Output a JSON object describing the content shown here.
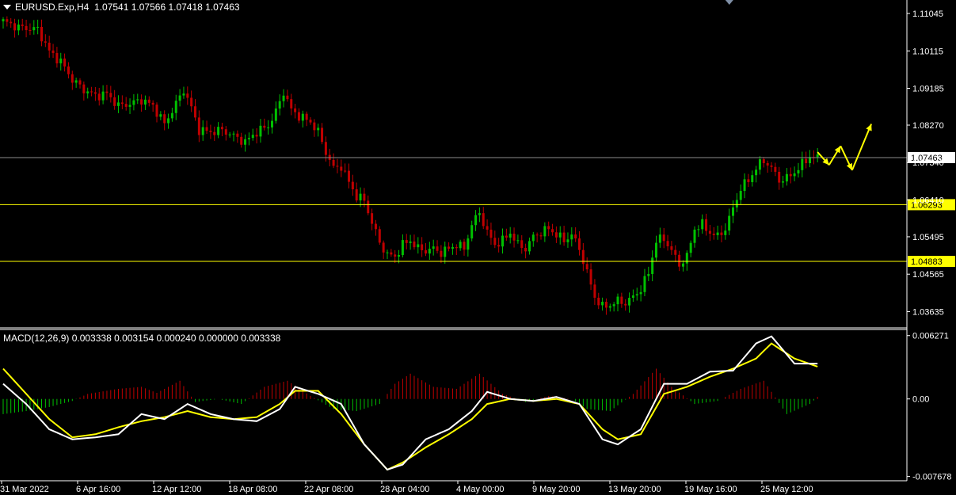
{
  "header": {
    "symbol": "EURUSD.Exp,H4",
    "ohlc": "1.07541 1.07566 1.07418 1.07463"
  },
  "macd_header": {
    "label": "MACD(12,26,9) 0.003338 0.003154 0.000240 0.000000 0.003338"
  },
  "colors": {
    "background": "#000000",
    "bull": "#00c000",
    "bear": "#c00000",
    "macd_line": "#ffffff",
    "signal_line": "#ffff00",
    "level_line": "#ffff00",
    "current_line": "#8c8c8c",
    "arrow": "#ffff00"
  },
  "chart_data": [
    {
      "type": "candlestick",
      "symbol": "EURUSD.Exp",
      "timeframe": "H4",
      "ylim": [
        1.0325,
        1.1138
      ],
      "y_ticks": [
        "1.11045",
        "1.10115",
        "1.09185",
        "1.08270",
        "1.07340",
        "1.06410",
        "1.05495",
        "1.04565",
        "1.03635"
      ],
      "x_ticks": [
        "31 Mar 2022",
        "6 Apr 16:00",
        "12 Apr 12:00",
        "18 Apr 08:00",
        "22 Apr 08:00",
        "28 Apr 04:00",
        "4 May 00:00",
        "9 May 20:00",
        "13 May 20:00",
        "19 May 16:00",
        "25 May 12:00"
      ],
      "close_path": [
        {
          "t": 0,
          "v": 1.1085
        },
        {
          "t": 4,
          "v": 1.107
        },
        {
          "t": 9,
          "v": 1.1065
        },
        {
          "t": 12,
          "v": 1.101
        },
        {
          "t": 15,
          "v": 1.0985
        },
        {
          "t": 18,
          "v": 1.094
        },
        {
          "t": 21,
          "v": 1.0915
        },
        {
          "t": 24,
          "v": 1.09
        },
        {
          "t": 27,
          "v": 1.0905
        },
        {
          "t": 30,
          "v": 1.0875
        },
        {
          "t": 33,
          "v": 1.088
        },
        {
          "t": 36,
          "v": 1.089
        },
        {
          "t": 39,
          "v": 1.0875
        },
        {
          "t": 42,
          "v": 1.083
        },
        {
          "t": 45,
          "v": 1.088
        },
        {
          "t": 47,
          "v": 1.0915
        },
        {
          "t": 49,
          "v": 1.087
        },
        {
          "t": 51,
          "v": 1.0815
        },
        {
          "t": 54,
          "v": 1.081
        },
        {
          "t": 57,
          "v": 1.0815
        },
        {
          "t": 60,
          "v": 1.08
        },
        {
          "t": 63,
          "v": 1.0785
        },
        {
          "t": 66,
          "v": 1.081
        },
        {
          "t": 69,
          "v": 1.0825
        },
        {
          "t": 71,
          "v": 1.086
        },
        {
          "t": 73,
          "v": 1.091
        },
        {
          "t": 75,
          "v": 1.0865
        },
        {
          "t": 77,
          "v": 1.085
        },
        {
          "t": 80,
          "v": 1.0835
        },
        {
          "t": 82,
          "v": 1.081
        },
        {
          "t": 84,
          "v": 1.076
        },
        {
          "t": 86,
          "v": 1.072
        },
        {
          "t": 88,
          "v": 1.0725
        },
        {
          "t": 90,
          "v": 1.0685
        },
        {
          "t": 92,
          "v": 1.065
        },
        {
          "t": 94,
          "v": 1.064
        },
        {
          "t": 96,
          "v": 1.0585
        },
        {
          "t": 98,
          "v": 1.0535
        },
        {
          "t": 100,
          "v": 1.0505
        },
        {
          "t": 102,
          "v": 1.05
        },
        {
          "t": 104,
          "v": 1.053
        },
        {
          "t": 106,
          "v": 1.054
        },
        {
          "t": 108,
          "v": 1.052
        },
        {
          "t": 110,
          "v": 1.0515
        },
        {
          "t": 112,
          "v": 1.052
        },
        {
          "t": 114,
          "v": 1.051
        },
        {
          "t": 116,
          "v": 1.052
        },
        {
          "t": 118,
          "v": 1.053
        },
        {
          "t": 120,
          "v": 1.052
        },
        {
          "t": 122,
          "v": 1.058
        },
        {
          "t": 124,
          "v": 1.061
        },
        {
          "t": 126,
          "v": 1.056
        },
        {
          "t": 128,
          "v": 1.053
        },
        {
          "t": 130,
          "v": 1.054
        },
        {
          "t": 132,
          "v": 1.056
        },
        {
          "t": 134,
          "v": 1.053
        },
        {
          "t": 136,
          "v": 1.052
        },
        {
          "t": 138,
          "v": 1.055
        },
        {
          "t": 140,
          "v": 1.056
        },
        {
          "t": 142,
          "v": 1.057
        },
        {
          "t": 144,
          "v": 1.0555
        },
        {
          "t": 146,
          "v": 1.054
        },
        {
          "t": 148,
          "v": 1.0555
        },
        {
          "t": 150,
          "v": 1.052
        },
        {
          "t": 152,
          "v": 1.046
        },
        {
          "t": 154,
          "v": 1.04
        },
        {
          "t": 156,
          "v": 1.0375
        },
        {
          "t": 158,
          "v": 1.038
        },
        {
          "t": 160,
          "v": 1.039
        },
        {
          "t": 162,
          "v": 1.0385
        },
        {
          "t": 164,
          "v": 1.04
        },
        {
          "t": 166,
          "v": 1.042
        },
        {
          "t": 168,
          "v": 1.046
        },
        {
          "t": 170,
          "v": 1.054
        },
        {
          "t": 172,
          "v": 1.0545
        },
        {
          "t": 174,
          "v": 1.0515
        },
        {
          "t": 176,
          "v": 1.048
        },
        {
          "t": 178,
          "v": 1.05
        },
        {
          "t": 180,
          "v": 1.057
        },
        {
          "t": 182,
          "v": 1.058
        },
        {
          "t": 184,
          "v": 1.056
        },
        {
          "t": 186,
          "v": 1.055
        },
        {
          "t": 188,
          "v": 1.057
        },
        {
          "t": 190,
          "v": 1.062
        },
        {
          "t": 192,
          "v": 1.067
        },
        {
          "t": 194,
          "v": 1.069
        },
        {
          "t": 196,
          "v": 1.072
        },
        {
          "t": 198,
          "v": 1.074
        },
        {
          "t": 200,
          "v": 1.072
        },
        {
          "t": 202,
          "v": 1.069
        },
        {
          "t": 204,
          "v": 1.0695
        },
        {
          "t": 206,
          "v": 1.071
        },
        {
          "t": 208,
          "v": 1.073
        },
        {
          "t": 210,
          "v": 1.075
        },
        {
          "t": 212,
          "v": 1.0745
        }
      ],
      "horizontal_lines": [
        {
          "label": "1.07463",
          "value": 1.07463,
          "kind": "current"
        },
        {
          "label": "1.06293",
          "value": 1.06293,
          "kind": "level"
        },
        {
          "label": "1.04883",
          "value": 1.04883,
          "kind": "level"
        }
      ],
      "forecast_arrows": [
        {
          "from": {
            "t": 212,
            "v": 1.076
          },
          "to": {
            "t": 215,
            "v": 1.0728
          }
        },
        {
          "from": {
            "t": 215,
            "v": 1.0728
          },
          "to": {
            "t": 218,
            "v": 1.0775
          }
        },
        {
          "from": {
            "t": 218,
            "v": 1.0775
          },
          "to": {
            "t": 221,
            "v": 1.0715
          }
        },
        {
          "from": {
            "t": 221,
            "v": 1.0715
          },
          "to": {
            "t": 226,
            "v": 1.083
          }
        }
      ]
    },
    {
      "type": "line",
      "name": "MACD(12,26,9)",
      "ylim": [
        -0.0081,
        0.0068
      ],
      "y_ticks": [
        "0.006271",
        "0.00",
        "-0.007678"
      ],
      "main": [
        {
          "t": 0,
          "v": 0.0015
        },
        {
          "t": 6,
          "v": -0.0005
        },
        {
          "t": 12,
          "v": -0.003
        },
        {
          "t": 18,
          "v": -0.004
        },
        {
          "t": 24,
          "v": -0.0038
        },
        {
          "t": 30,
          "v": -0.0035
        },
        {
          "t": 36,
          "v": -0.0015
        },
        {
          "t": 42,
          "v": -0.002
        },
        {
          "t": 48,
          "v": -0.0005
        },
        {
          "t": 54,
          "v": -0.0015
        },
        {
          "t": 60,
          "v": -0.002
        },
        {
          "t": 66,
          "v": -0.0022
        },
        {
          "t": 72,
          "v": -0.001
        },
        {
          "t": 76,
          "v": 0.0012
        },
        {
          "t": 82,
          "v": 0.0005
        },
        {
          "t": 88,
          "v": -0.0005
        },
        {
          "t": 94,
          "v": -0.0045
        },
        {
          "t": 100,
          "v": -0.007
        },
        {
          "t": 104,
          "v": -0.0065
        },
        {
          "t": 110,
          "v": -0.004
        },
        {
          "t": 116,
          "v": -0.003
        },
        {
          "t": 122,
          "v": -0.0012
        },
        {
          "t": 126,
          "v": 0.0007
        },
        {
          "t": 132,
          "v": 0.0
        },
        {
          "t": 138,
          "v": -0.0002
        },
        {
          "t": 144,
          "v": 0.0002
        },
        {
          "t": 150,
          "v": -0.0005
        },
        {
          "t": 156,
          "v": -0.004
        },
        {
          "t": 160,
          "v": -0.0045
        },
        {
          "t": 166,
          "v": -0.003
        },
        {
          "t": 172,
          "v": 0.0015
        },
        {
          "t": 178,
          "v": 0.0015
        },
        {
          "t": 184,
          "v": 0.0027
        },
        {
          "t": 190,
          "v": 0.0028
        },
        {
          "t": 196,
          "v": 0.0055
        },
        {
          "t": 200,
          "v": 0.0062
        },
        {
          "t": 206,
          "v": 0.0035
        },
        {
          "t": 212,
          "v": 0.0035
        }
      ],
      "signal": [
        {
          "t": 0,
          "v": 0.003
        },
        {
          "t": 6,
          "v": 0.0005
        },
        {
          "t": 12,
          "v": -0.002
        },
        {
          "t": 18,
          "v": -0.0038
        },
        {
          "t": 24,
          "v": -0.0035
        },
        {
          "t": 30,
          "v": -0.0028
        },
        {
          "t": 36,
          "v": -0.0022
        },
        {
          "t": 42,
          "v": -0.0018
        },
        {
          "t": 48,
          "v": -0.0012
        },
        {
          "t": 54,
          "v": -0.0018
        },
        {
          "t": 60,
          "v": -0.002
        },
        {
          "t": 66,
          "v": -0.0018
        },
        {
          "t": 72,
          "v": -0.0005
        },
        {
          "t": 76,
          "v": 0.0008
        },
        {
          "t": 82,
          "v": 0.0008
        },
        {
          "t": 88,
          "v": -0.0015
        },
        {
          "t": 94,
          "v": -0.0045
        },
        {
          "t": 100,
          "v": -0.007
        },
        {
          "t": 104,
          "v": -0.0063
        },
        {
          "t": 110,
          "v": -0.0048
        },
        {
          "t": 116,
          "v": -0.0035
        },
        {
          "t": 122,
          "v": -0.002
        },
        {
          "t": 126,
          "v": -0.0005
        },
        {
          "t": 132,
          "v": 0.0
        },
        {
          "t": 138,
          "v": -0.0002
        },
        {
          "t": 144,
          "v": 0.0
        },
        {
          "t": 150,
          "v": -0.0005
        },
        {
          "t": 156,
          "v": -0.003
        },
        {
          "t": 160,
          "v": -0.004
        },
        {
          "t": 166,
          "v": -0.0035
        },
        {
          "t": 172,
          "v": 0.0005
        },
        {
          "t": 178,
          "v": 0.0012
        },
        {
          "t": 184,
          "v": 0.0022
        },
        {
          "t": 190,
          "v": 0.003
        },
        {
          "t": 196,
          "v": 0.004
        },
        {
          "t": 200,
          "v": 0.0055
        },
        {
          "t": 206,
          "v": 0.004
        },
        {
          "t": 212,
          "v": 0.0032
        }
      ],
      "histogram": [
        {
          "t": 0,
          "v": -0.0015
        },
        {
          "t": 6,
          "v": -0.0012
        },
        {
          "t": 12,
          "v": -0.0008
        },
        {
          "t": 18,
          "v": -0.0002
        },
        {
          "t": 22,
          "v": 0.0005
        },
        {
          "t": 30,
          "v": 0.001
        },
        {
          "t": 36,
          "v": 0.0012
        },
        {
          "t": 40,
          "v": 0.0006
        },
        {
          "t": 46,
          "v": 0.0018
        },
        {
          "t": 50,
          "v": -0.0003
        },
        {
          "t": 56,
          "v": 0.0
        },
        {
          "t": 62,
          "v": -0.0005
        },
        {
          "t": 68,
          "v": 0.0012
        },
        {
          "t": 74,
          "v": 0.0018
        },
        {
          "t": 80,
          "v": 0.0003
        },
        {
          "t": 86,
          "v": -0.001
        },
        {
          "t": 92,
          "v": -0.0012
        },
        {
          "t": 98,
          "v": -0.0005
        },
        {
          "t": 102,
          "v": 0.0015
        },
        {
          "t": 106,
          "v": 0.0025
        },
        {
          "t": 112,
          "v": 0.0012
        },
        {
          "t": 118,
          "v": 0.001
        },
        {
          "t": 124,
          "v": 0.0025
        },
        {
          "t": 130,
          "v": 0.0005
        },
        {
          "t": 136,
          "v": -0.0003
        },
        {
          "t": 142,
          "v": 0.0003
        },
        {
          "t": 148,
          "v": 0.0
        },
        {
          "t": 152,
          "v": -0.001
        },
        {
          "t": 158,
          "v": -0.0012
        },
        {
          "t": 164,
          "v": 0.0005
        },
        {
          "t": 170,
          "v": 0.003
        },
        {
          "t": 174,
          "v": 0.0012
        },
        {
          "t": 180,
          "v": -0.0005
        },
        {
          "t": 186,
          "v": -0.0002
        },
        {
          "t": 192,
          "v": 0.001
        },
        {
          "t": 198,
          "v": 0.0018
        },
        {
          "t": 204,
          "v": -0.0015
        },
        {
          "t": 210,
          "v": -0.0005
        },
        {
          "t": 212,
          "v": 0.0002
        }
      ]
    }
  ]
}
